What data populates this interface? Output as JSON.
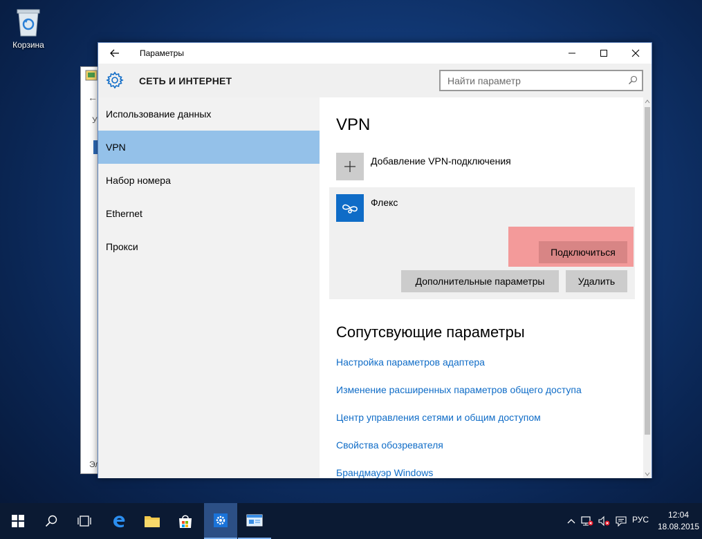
{
  "desktop": {
    "recycle_bin_label": "Корзина"
  },
  "background_window": {
    "partial_y": "У",
    "partial_el": "Эл"
  },
  "window": {
    "title": "Параметры",
    "section_title": "СЕТЬ И ИНТЕРНЕТ",
    "search_placeholder": "Найти параметр"
  },
  "sidebar": {
    "items": [
      {
        "label": "Использование данных"
      },
      {
        "label": "VPN",
        "active": true
      },
      {
        "label": "Набор номера"
      },
      {
        "label": "Ethernet"
      },
      {
        "label": "Прокси"
      }
    ]
  },
  "content": {
    "heading": "VPN",
    "add_vpn_label": "Добавление VPN-подключения",
    "vpn_connection": {
      "name": "Флекс",
      "connect_label": "Подключиться",
      "advanced_label": "Дополнительные параметры",
      "delete_label": "Удалить"
    },
    "related_heading": "Сопутсвующие параметры",
    "related_links": [
      {
        "label": "Настройка параметров адаптера"
      },
      {
        "label": "Изменение расширенных параметров общего доступа"
      },
      {
        "label": "Центр управления сетями и общим доступом"
      },
      {
        "label": "Свойства обозревателя"
      },
      {
        "label": "Брандмауэр Windows"
      }
    ]
  },
  "taskbar": {
    "language": "РУС",
    "time": "12:04",
    "date": "18.08.2015"
  },
  "colors": {
    "accent": "#0f6cc7",
    "nav_active": "#94c1e9",
    "highlight": "#f39a9a"
  }
}
